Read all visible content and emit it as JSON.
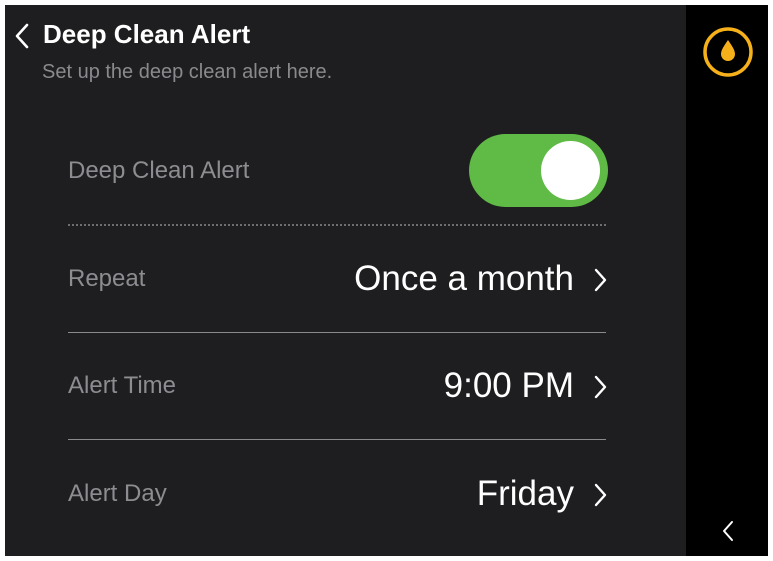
{
  "header": {
    "title": "Deep Clean Alert",
    "subtitle": "Set up the deep clean alert here."
  },
  "settings": {
    "alert_toggle": {
      "label": "Deep Clean Alert",
      "enabled": true
    },
    "repeat": {
      "label": "Repeat",
      "value": "Once a month"
    },
    "alert_time": {
      "label": "Alert Time",
      "value": "9:00 PM"
    },
    "alert_day": {
      "label": "Alert Day",
      "value": "Friday"
    }
  },
  "sidebar": {
    "top_icon": "water-drop-icon",
    "bottom_icon": "chevron-left-icon"
  },
  "colors": {
    "background": "#1e1e20",
    "sidebar": "#000000",
    "toggle_on": "#5fbb46",
    "accent_amber": "#f5b01a"
  }
}
